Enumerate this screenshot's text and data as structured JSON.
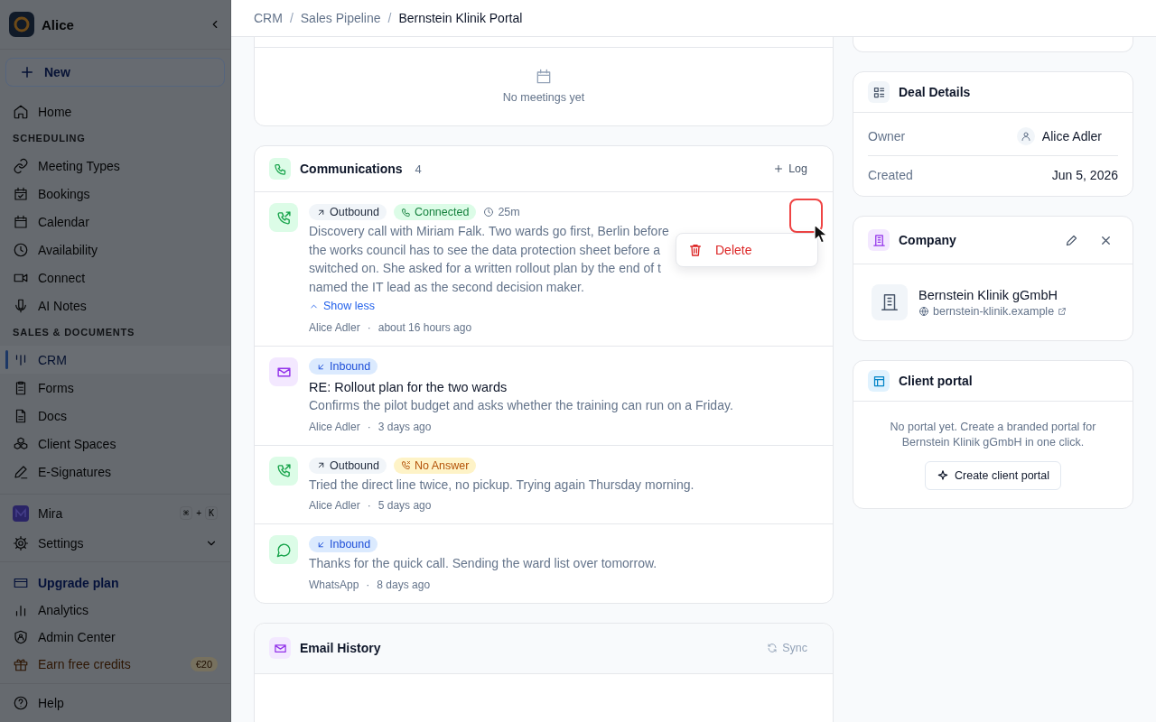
{
  "sidebar": {
    "dimmed": true,
    "workspace": "Alice",
    "new_button": "New",
    "sections": [
      {
        "items": [
          {
            "label": "Home",
            "selected": false
          }
        ]
      },
      {
        "heading": "SCHEDULING",
        "items": [
          {
            "label": "Meeting Types",
            "selected": false
          },
          {
            "label": "Bookings",
            "selected": false
          },
          {
            "label": "Calendar",
            "selected": false
          },
          {
            "label": "Availability",
            "selected": false
          },
          {
            "label": "Connect",
            "selected": false
          },
          {
            "label": "AI Notes",
            "selected": false
          }
        ]
      },
      {
        "heading": "SALES & DOCUMENTS",
        "items": [
          {
            "label": "CRM",
            "selected": true
          },
          {
            "label": "Forms",
            "selected": false
          },
          {
            "label": "Docs",
            "selected": false
          },
          {
            "label": "Client Spaces",
            "selected": false
          },
          {
            "label": "E-Signatures",
            "selected": false
          }
        ]
      }
    ],
    "assistant": {
      "label": "Mira",
      "keys": [
        "⌘",
        "K"
      ],
      "joiner": "+"
    },
    "settings": {
      "label": "Settings"
    },
    "footer_links": [
      {
        "label": "Upgrade plan",
        "kind": "upgrade"
      },
      {
        "label": "Analytics",
        "kind": "link"
      },
      {
        "label": "Admin Center",
        "kind": "link"
      },
      {
        "label": "Earn free credits",
        "kind": "reward",
        "badge": "€20"
      }
    ],
    "help": "Help"
  },
  "breadcrumb": {
    "separator": "/",
    "items": [
      "CRM",
      "Sales Pipeline",
      "Bernstein Klinik Portal"
    ]
  },
  "meetings": {
    "empty_text": "No meetings yet"
  },
  "communications": {
    "title": "Communications",
    "count": "4",
    "action": "Log",
    "meta_separator": "·",
    "items": [
      {
        "kind": "call",
        "direction": {
          "label": "Outbound",
          "kind": "outbound"
        },
        "status": {
          "label": "Connected",
          "kind": "connected"
        },
        "duration": "25m",
        "lines": [
          "Discovery call with Miriam Falk. Two wards go first, Berlin before",
          "the works council has to see the data protection sheet before a",
          "switched on. She asked for a written rollout plan by the end of t",
          "named the IT lead as the second decision maker."
        ],
        "toggle": "Show less",
        "author": "Alice Adler",
        "time": "about 16 hours ago",
        "actions_focused": true,
        "menu": [
          {
            "label": "Delete",
            "kind": "danger"
          }
        ]
      },
      {
        "kind": "email",
        "direction": {
          "label": "Inbound",
          "kind": "inbound"
        },
        "subject": "RE: Rollout plan for the two wards",
        "lines": [
          "Confirms the pilot budget and asks whether the training can run on a Friday."
        ],
        "author": "Alice Adler",
        "time": "3 days ago",
        "actions_focused": false
      },
      {
        "kind": "call",
        "direction": {
          "label": "Outbound",
          "kind": "outbound"
        },
        "status": {
          "label": "No Answer",
          "kind": "no_answer"
        },
        "lines": [
          "Tried the direct line twice, no pickup. Trying again Thursday morning."
        ],
        "author": "Alice Adler",
        "time": "5 days ago",
        "actions_focused": false
      },
      {
        "kind": "whatsapp",
        "direction": {
          "label": "Inbound",
          "kind": "inbound"
        },
        "lines": [
          "Thanks for the quick call. Sending the ward list over tomorrow."
        ],
        "author": "WhatsApp",
        "time": "8 days ago",
        "actions_focused": false
      }
    ]
  },
  "email_history": {
    "title": "Email History",
    "sync": {
      "label": "Sync",
      "disabled": true
    }
  },
  "deal_details": {
    "title": "Deal Details",
    "fields": [
      {
        "label": "Owner",
        "value": "Alice Adler",
        "kind": "person"
      },
      {
        "label": "Created",
        "value": "Jun 5, 2026",
        "kind": "text"
      }
    ]
  },
  "company": {
    "title": "Company",
    "name": "Bernstein Klinik gGmbH",
    "website": "bernstein-klinik.example"
  },
  "client_portal": {
    "title": "Client portal",
    "description": "No portal yet. Create a branded portal for Bernstein Klinik gGmbH in one click.",
    "button": "Create client portal"
  }
}
